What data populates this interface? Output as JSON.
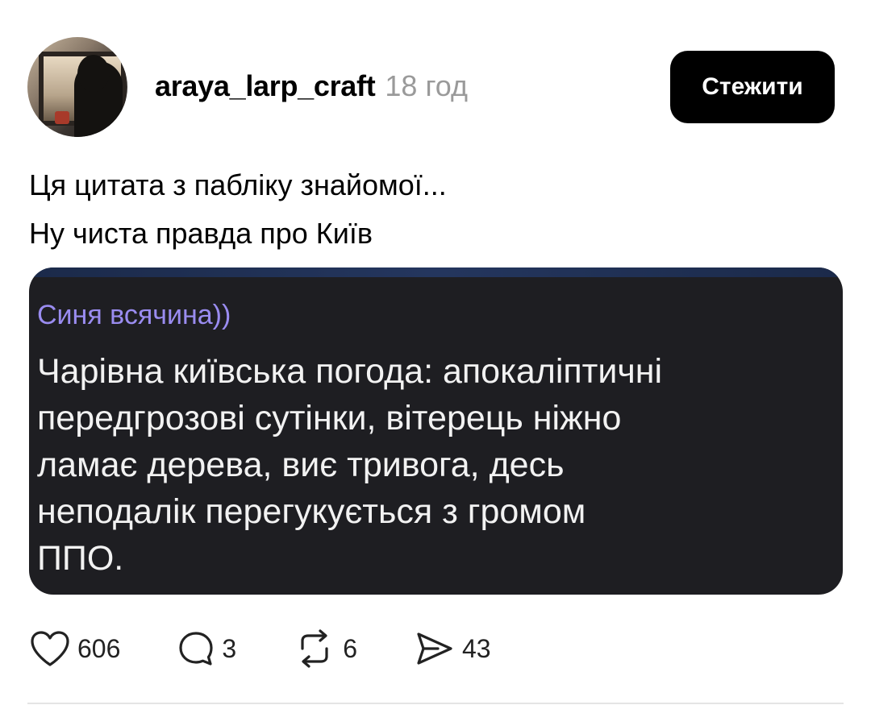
{
  "post": {
    "username": "araya_larp_craft",
    "timestamp": "18 год",
    "follow_label": "Стежити",
    "caption": [
      "Ця цитата з пабліку знайомої...",
      "Ну чиста правда про Київ"
    ],
    "media": {
      "sender": "Синя всячина))",
      "message_lines": [
        "Чарівна київська погода: апокаліптичні",
        "передгрозові сутінки, вітерець ніжно",
        "ламає дерева, виє тривога, десь",
        "неподалік перегукується з громом",
        "ППО."
      ]
    },
    "actions": {
      "likes": "606",
      "comments": "3",
      "reposts": "6",
      "shares": "43"
    }
  },
  "icons": {
    "like": "heart-icon",
    "comment": "comment-bubble-icon",
    "repost": "repost-arrows-icon",
    "share": "send-arrow-icon"
  },
  "colors": {
    "follow_button_bg": "#000000",
    "timestamp": "#9a9a9a",
    "media_bg": "#1e1e22",
    "sender_name": "#9a8cf0"
  }
}
